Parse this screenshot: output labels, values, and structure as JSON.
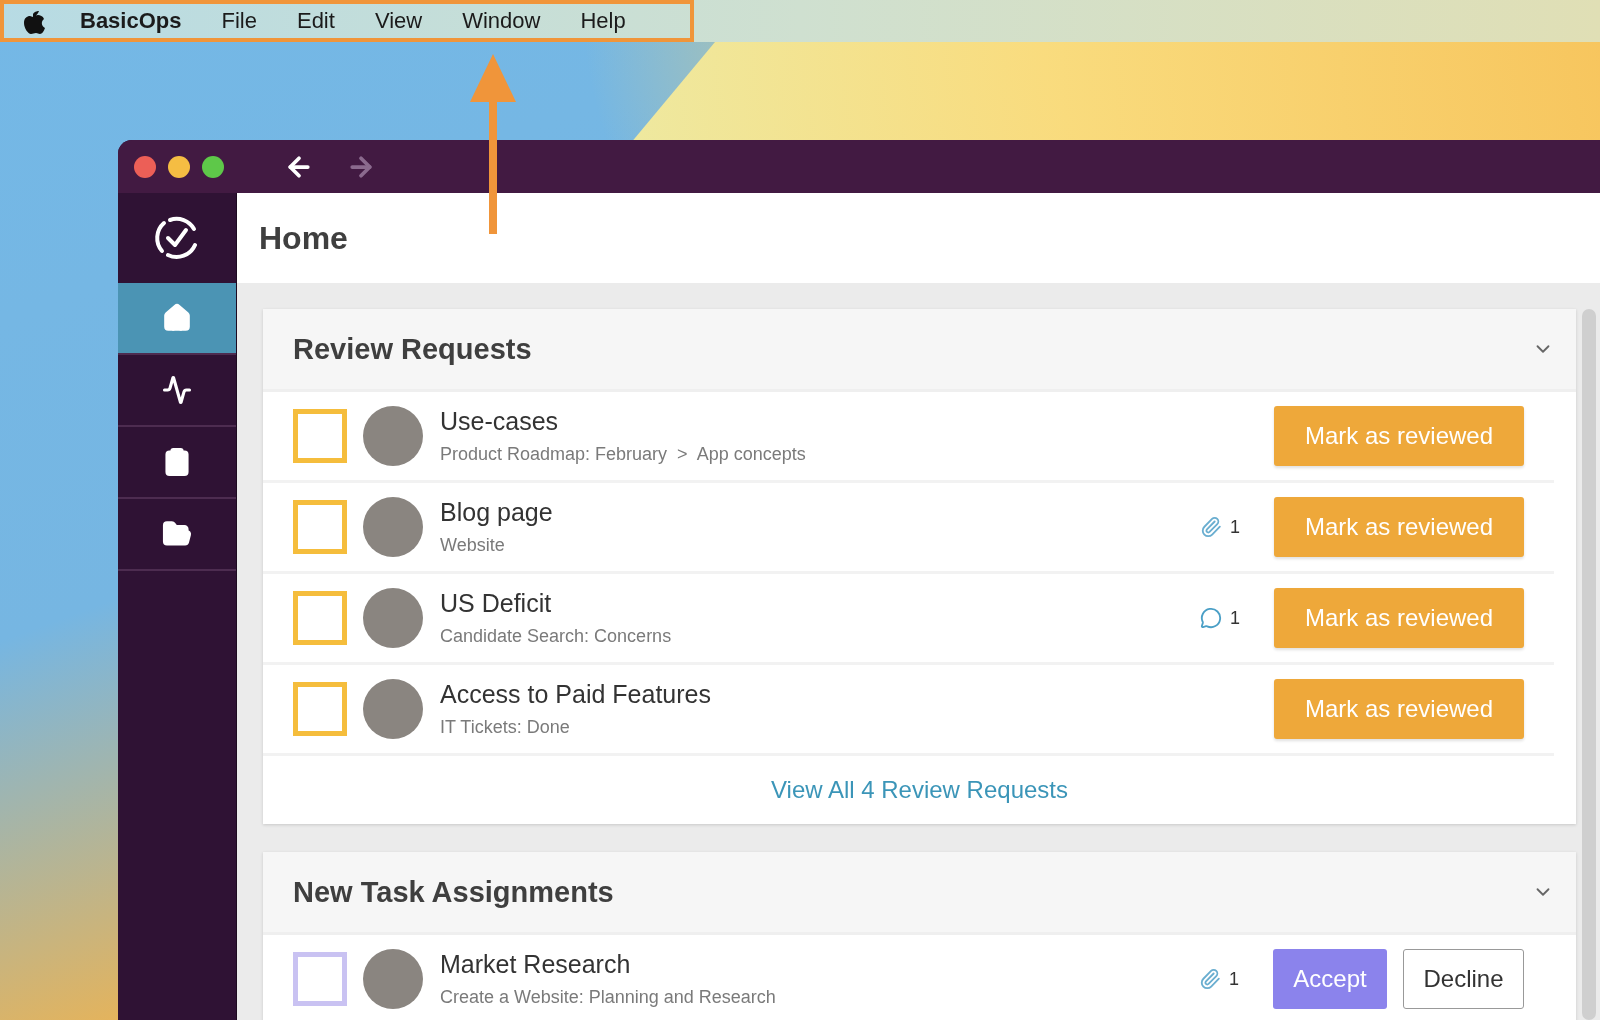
{
  "menu_bar": {
    "app_name": "BasicOps",
    "items": [
      "File",
      "Edit",
      "View",
      "Window",
      "Help"
    ]
  },
  "annotation": {
    "highlighted": true
  },
  "window": {
    "nav_back_enabled": true,
    "nav_forward_enabled": false
  },
  "sidebar": {
    "items": [
      {
        "kind": "home",
        "selected": true
      },
      {
        "kind": "activity",
        "selected": false
      },
      {
        "kind": "tasks",
        "selected": false
      },
      {
        "kind": "projects",
        "selected": false
      }
    ]
  },
  "page": {
    "title": "Home"
  },
  "sections": [
    {
      "title": "Review Requests",
      "kind": "review",
      "expanded": true,
      "rows": [
        {
          "title": "Use-cases",
          "path": "Product Roadmap: February  >  App concepts",
          "checked": false,
          "meta": null,
          "actions": [
            {
              "kind": "review",
              "label": "Mark as reviewed"
            }
          ]
        },
        {
          "title": "Blog page",
          "path": "Website",
          "checked": false,
          "meta": {
            "kind": "attachment",
            "count": "1"
          },
          "actions": [
            {
              "kind": "review",
              "label": "Mark as reviewed"
            }
          ]
        },
        {
          "title": "US Deficit",
          "path": "Candidate Search: Concerns",
          "checked": false,
          "meta": {
            "kind": "comment",
            "count": "1"
          },
          "actions": [
            {
              "kind": "review",
              "label": "Mark as reviewed"
            }
          ]
        },
        {
          "title": "Access to Paid Features",
          "path": "IT Tickets: Done",
          "checked": false,
          "meta": null,
          "actions": [
            {
              "kind": "review",
              "label": "Mark as reviewed"
            }
          ]
        }
      ],
      "footer_link": "View All 4 Review Requests"
    },
    {
      "title": "New Task Assignments",
      "kind": "assignment",
      "expanded": true,
      "rows": [
        {
          "title": "Market Research",
          "path": "Create a Website: Planning and Research",
          "checked": false,
          "meta": {
            "kind": "attachment",
            "count": "1"
          },
          "actions": [
            {
              "kind": "accept",
              "label": "Accept"
            },
            {
              "kind": "decline",
              "label": "Decline"
            }
          ]
        }
      ]
    }
  ]
}
